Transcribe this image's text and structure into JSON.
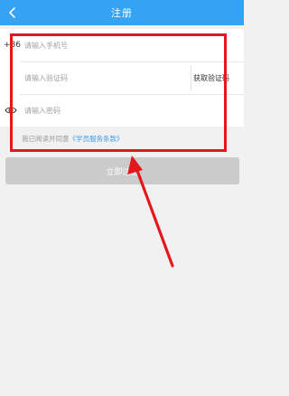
{
  "header": {
    "title": "注册",
    "back_icon": "chevron-left-icon",
    "background": "#35a3f2"
  },
  "form": {
    "phone": {
      "prefix": "+86",
      "placeholder": "请输入手机号",
      "value": ""
    },
    "code": {
      "placeholder": "请输入验证码",
      "value": "",
      "get_code_label": "获取验证码"
    },
    "password": {
      "placeholder": "请输入密码",
      "value": "",
      "toggle_icon": "eye-icon"
    }
  },
  "agreement": {
    "text": "我已阅读并同意",
    "link": "《学员服务条款》"
  },
  "register_button": {
    "label": "立即注册",
    "background": "#cbcbcb"
  },
  "annotations": {
    "highlight_color": "#e3171d"
  }
}
